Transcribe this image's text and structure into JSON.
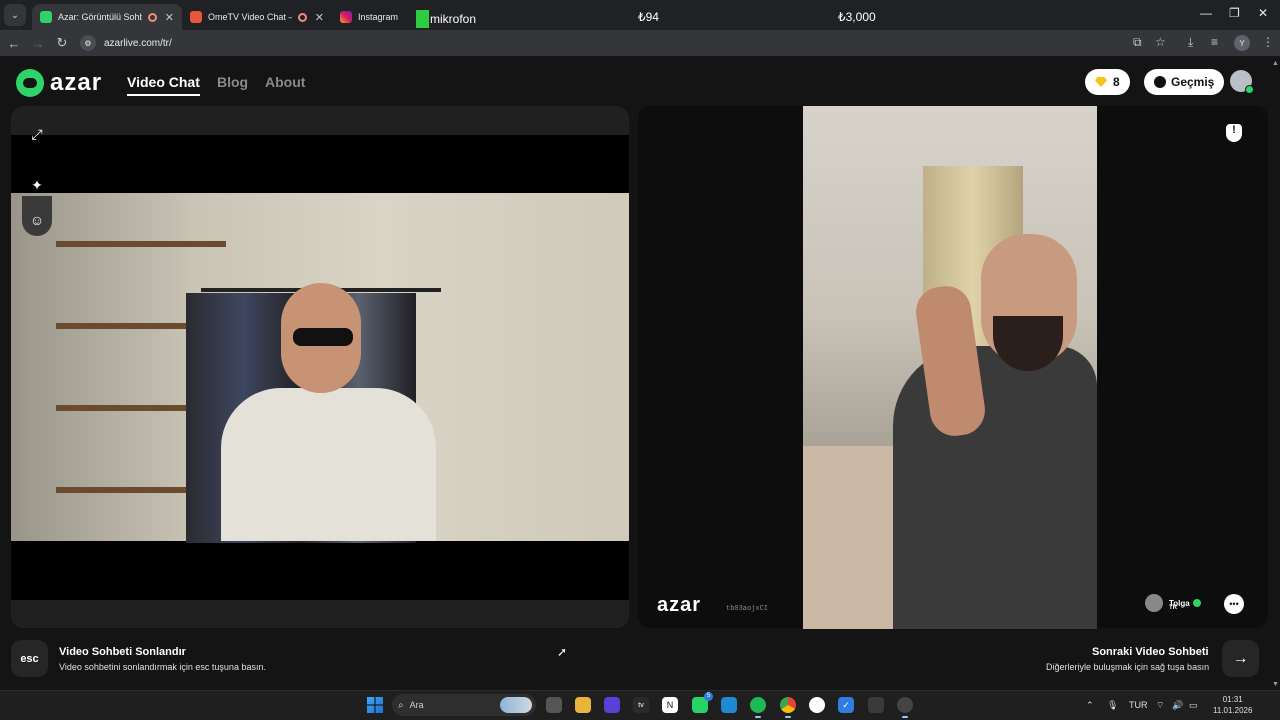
{
  "browser": {
    "tabs": [
      {
        "title": "Azar: Görüntülü Sohbet & Y",
        "active": true,
        "recording": true
      },
      {
        "title": "OmeTV Video Chat — Ome",
        "active": false,
        "recording": true
      },
      {
        "title": "Instagram",
        "active": false,
        "recording": false
      }
    ],
    "overlay_label": "mikrofon",
    "ticker_1": "₺94",
    "ticker_2": "₺3,000",
    "url": "azarlive.com/tr/",
    "profile_initial": "Y"
  },
  "site": {
    "brand": "azar",
    "nav": [
      "Video Chat",
      "Blog",
      "About"
    ],
    "gems": "8",
    "history_label": "Geçmiş",
    "watermark": "azar",
    "watermark_id": "tb03aojxCI",
    "peer": {
      "name": "Tolga",
      "country": "TR"
    }
  },
  "footer": {
    "esc_key": "esc",
    "end_title": "Video Sohbeti Sonlandır",
    "end_sub": "Video sohbetini sonlandırmak için esc tuşuna basın.",
    "next_title": "Sonraki Video Sohbeti",
    "next_sub": "Diğerleriyle buluşmak için sağ tuşa basın"
  },
  "taskbar": {
    "search_placeholder": "Ara",
    "lang": "TUR",
    "time": "01:31",
    "date": "11.01.2026",
    "whatsapp_badge": "5"
  },
  "colors": {
    "brand_green": "#2fd36a",
    "gem": "#f5c518"
  }
}
